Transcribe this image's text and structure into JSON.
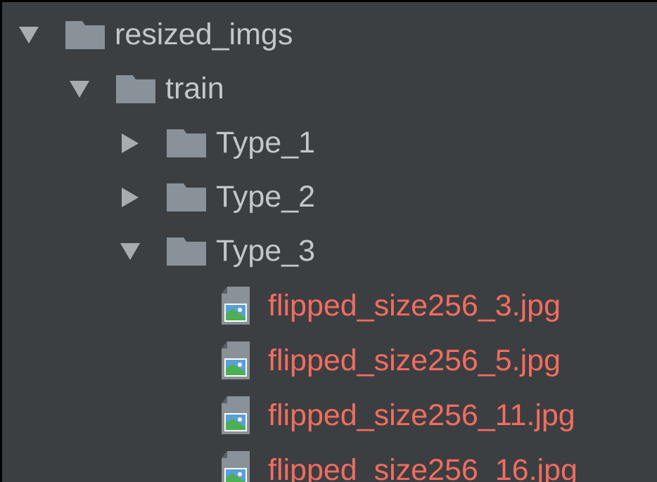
{
  "colors": {
    "background": "#3c3f41",
    "folder_text": "#c4c7c9",
    "file_text": "#f26d5f",
    "arrow": "#a9acae",
    "folder_icon": "#8a9299"
  },
  "tree": {
    "root": {
      "label": "resized_imgs",
      "expanded": true,
      "icon": "folder-icon"
    },
    "train": {
      "label": "train",
      "expanded": true,
      "icon": "folder-icon"
    },
    "folders": [
      {
        "label": "Type_1",
        "expanded": false,
        "icon": "folder-icon"
      },
      {
        "label": "Type_2",
        "expanded": false,
        "icon": "folder-icon"
      },
      {
        "label": "Type_3",
        "expanded": true,
        "icon": "folder-icon"
      }
    ],
    "files": [
      {
        "label": "flipped_size256_3.jpg",
        "icon": "image-file-icon"
      },
      {
        "label": "flipped_size256_5.jpg",
        "icon": "image-file-icon"
      },
      {
        "label": "flipped_size256_11.jpg",
        "icon": "image-file-icon"
      },
      {
        "label": "flipped_size256_16.jpg",
        "icon": "image-file-icon"
      }
    ]
  }
}
